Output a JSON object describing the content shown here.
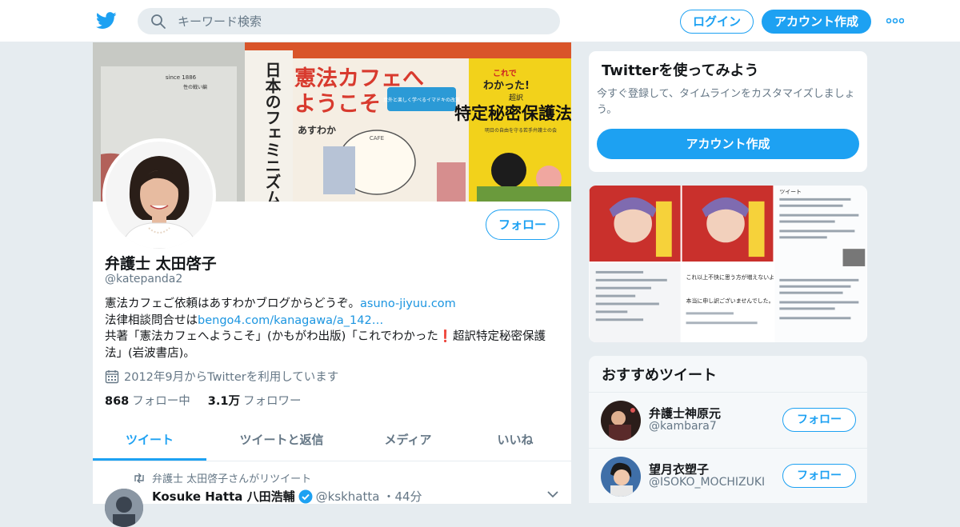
{
  "header": {
    "search_placeholder": "キーワード検索",
    "login_label": "ログイン",
    "signup_label": "アカウント作成"
  },
  "banner": {
    "book1_spine": "日本のフェミニズム",
    "book1_since": "since 1886",
    "book1_sub": "性の戦い編",
    "book2_title_a": "憲法カフェへ",
    "book2_title_b": "ようこそ",
    "book2_author": "あすわか",
    "book2_badge": "意外と楽しく学べるイマドキの改憲",
    "book2_cafe": "CAFE",
    "book3_top": "これで",
    "book3_top2": "わかった!",
    "book3_label": "超訳",
    "book3_title": "特定秘密保護法",
    "book3_sub": "明日の自由を守る若手弁護士の会"
  },
  "profile": {
    "follow_label": "フォロー",
    "name": "弁護士 太田啓子",
    "handle": "@katepanda2",
    "bio_line1": "憲法カフェご依頼はあすわかブログからどうぞ。",
    "bio_link1": "asuno-jiyuu.com",
    "bio_line2": "法律相談問合せは",
    "bio_link2": "bengo4.com/kanagawa/a_142…",
    "bio_line3a": "共著「憲法カフェへようこそ」(かもがわ出版)「これでわかった",
    "bio_exclaim": "❗",
    "bio_line3b": "超訳特定秘密保護法」(岩波書店)。",
    "joined": "2012年9月からTwitterを利用しています",
    "following_count": "868",
    "following_label": "フォロー中",
    "followers_count": "3.1万",
    "followers_label": "フォロワー"
  },
  "tabs": [
    {
      "label": "ツイート",
      "active": true
    },
    {
      "label": "ツイートと返信",
      "active": false
    },
    {
      "label": "メディア",
      "active": false
    },
    {
      "label": "いいね",
      "active": false
    }
  ],
  "tweet": {
    "retweet_text": "弁護士 太田啓子さんがリツイート",
    "author_name": "Kosuke Hatta 八田浩輔",
    "author_handle": "@kskhatta",
    "time": "・44分"
  },
  "try_card": {
    "title": "Twitterを使ってみよう",
    "desc": "今すぐ登録して、タイムラインをカスタマイズしましょう。",
    "button": "アカウント作成"
  },
  "media_card": {
    "thumb_label": "ツイート",
    "thumb_text1": "これ以上不快に思う方が増えないよう削除、非公開させていただきます。",
    "thumb_text2": "本当に申し訳ございませんでした。"
  },
  "recommend": {
    "title": "おすすめツイート",
    "items": [
      {
        "name": "弁護士神原元",
        "handle": "@kambara7",
        "button": "フォロー"
      },
      {
        "name": "望月衣塑子",
        "handle": "@ISOKO_MOCHIZUKI",
        "button": "フォロー"
      }
    ]
  },
  "colors": {
    "accent": "#1da1f2",
    "link": "#1b95e0",
    "muted": "#657786",
    "background": "#e6ecf0"
  }
}
